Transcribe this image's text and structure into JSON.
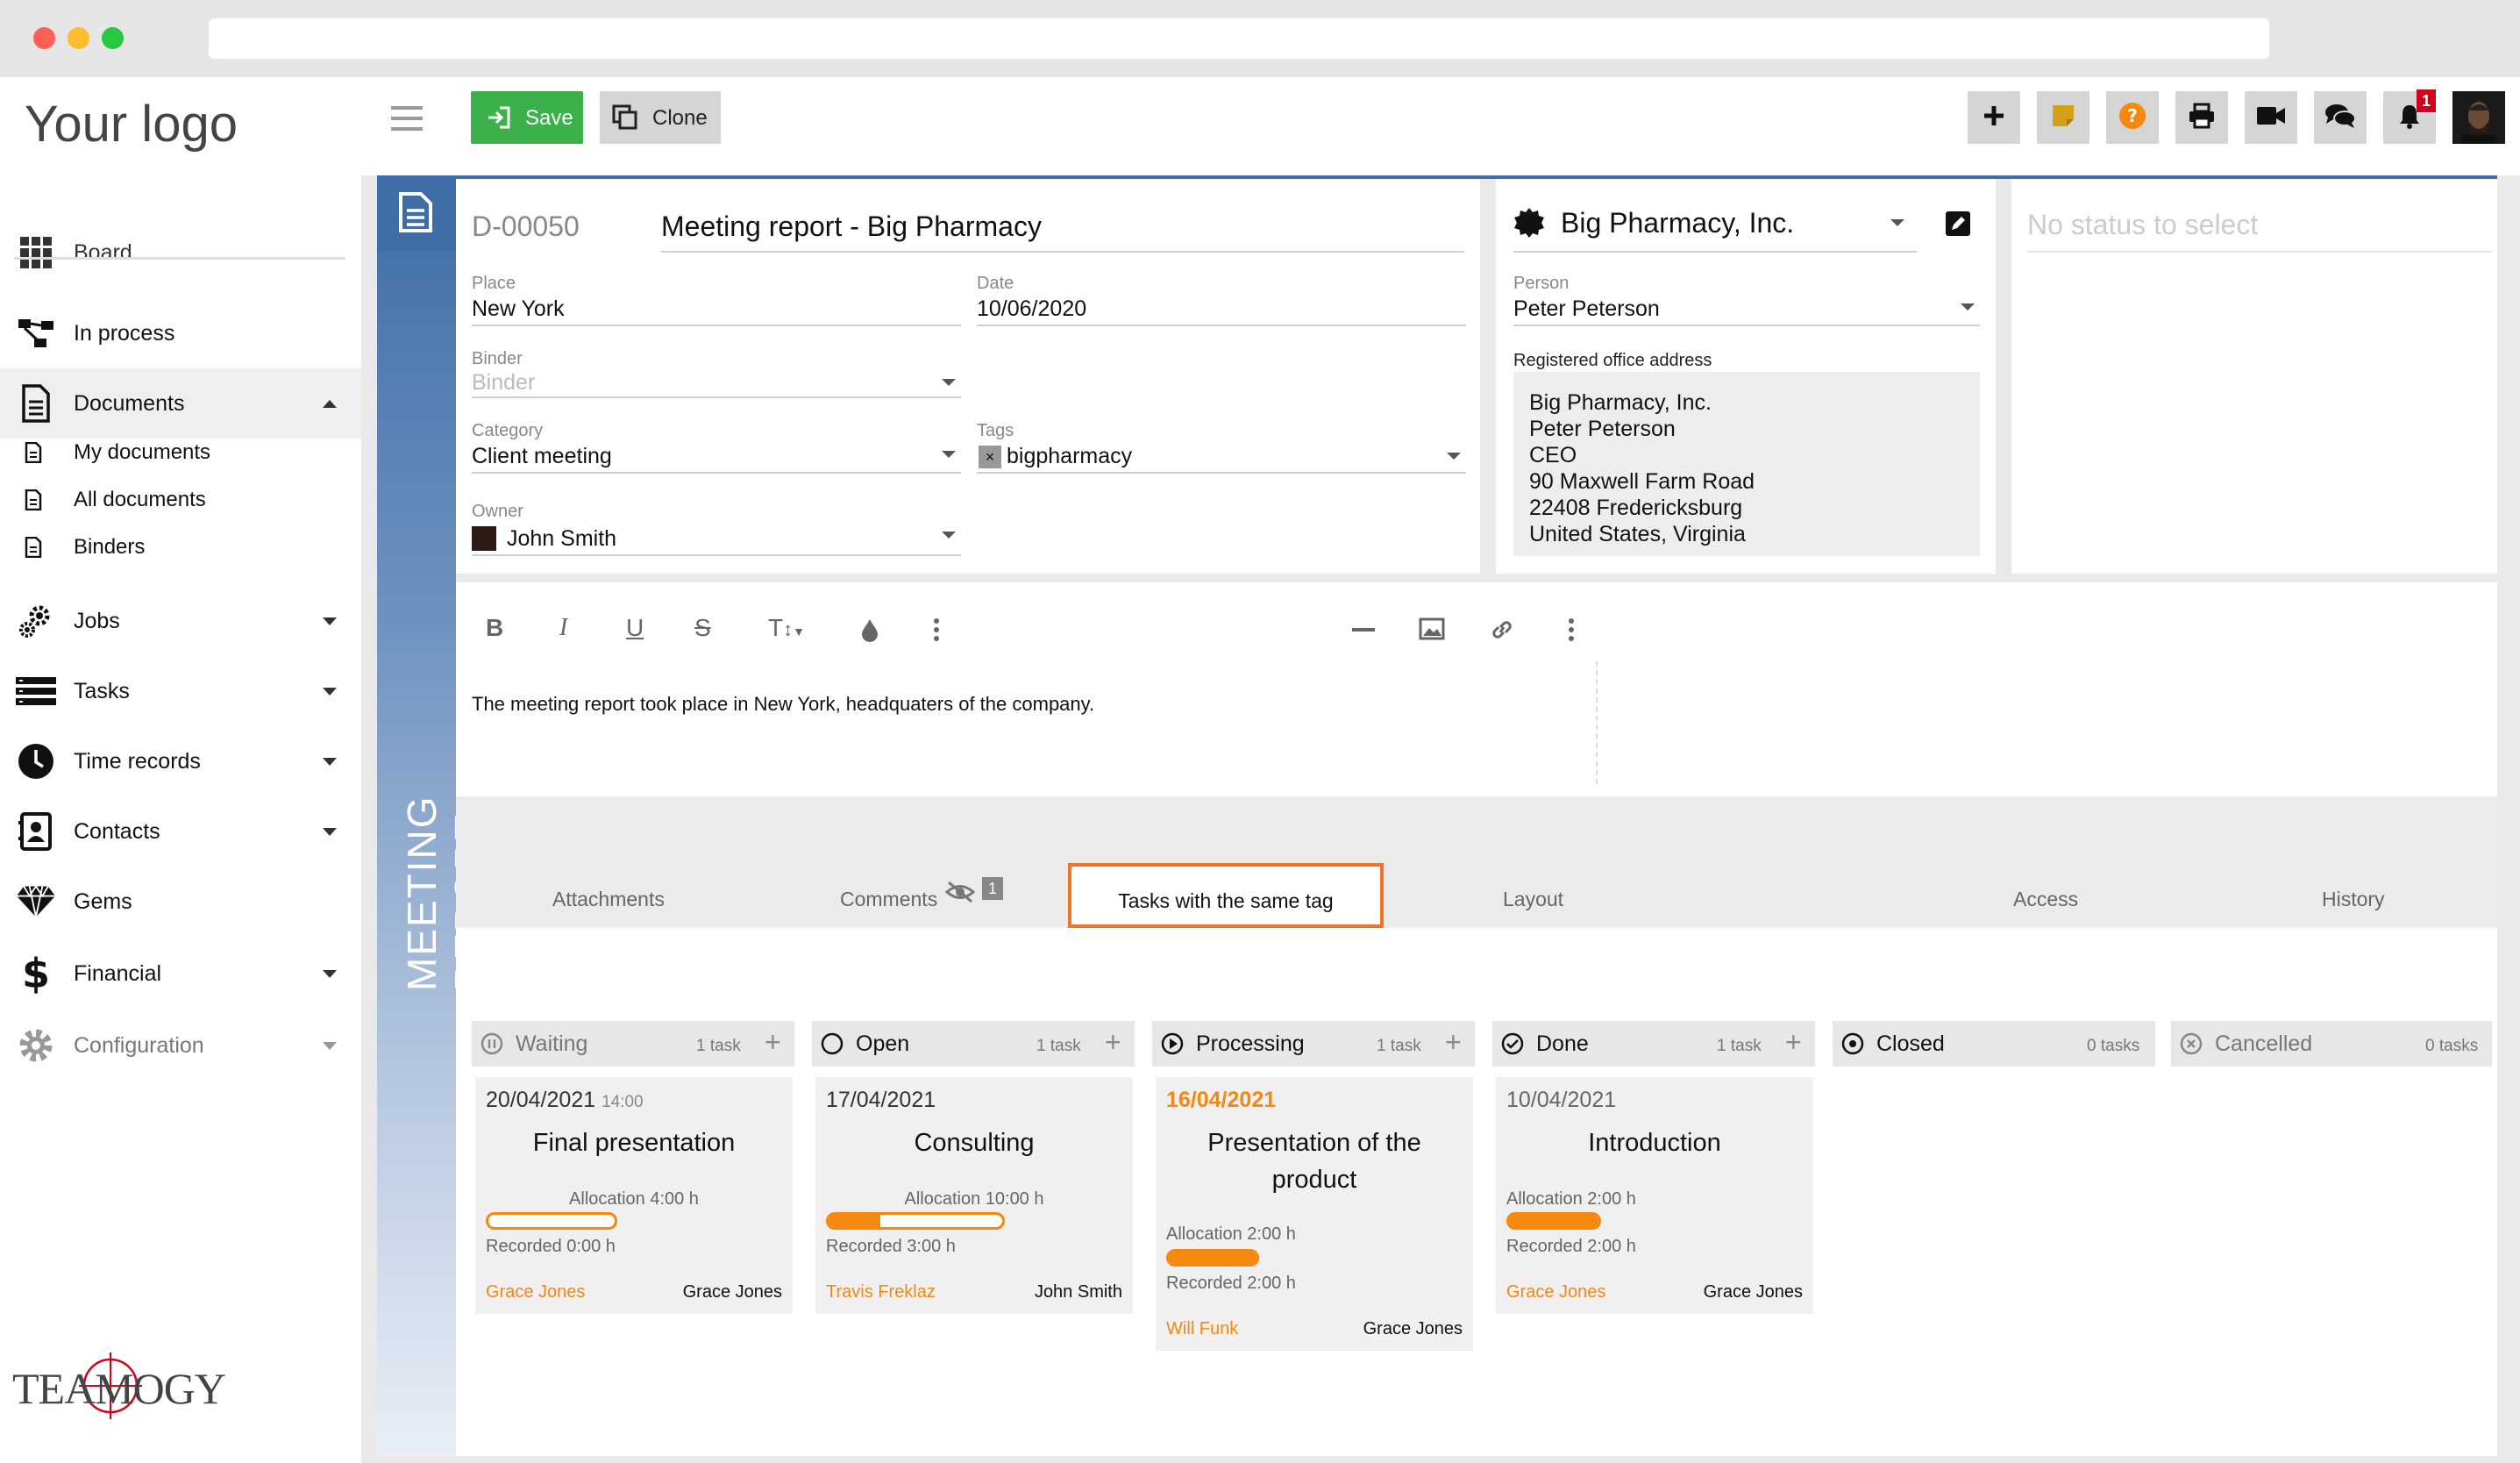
{
  "app": {
    "logo_text": "Your logo",
    "brand_text": "TEAMOGY"
  },
  "sidebar": {
    "items": [
      {
        "label": "Board",
        "icon": "grid-icon"
      },
      {
        "label": "In process",
        "icon": "flow-icon"
      },
      {
        "label": "Documents",
        "icon": "document-icon"
      },
      {
        "label": "Jobs",
        "icon": "gears-icon"
      },
      {
        "label": "Tasks",
        "icon": "tasks-icon"
      },
      {
        "label": "Time records",
        "icon": "clock-icon"
      },
      {
        "label": "Contacts",
        "icon": "contact-book-icon"
      },
      {
        "label": "Gems",
        "icon": "diamond-icon"
      },
      {
        "label": "Financial",
        "icon": "dollar-icon"
      },
      {
        "label": "Configuration",
        "icon": "gear-icon"
      }
    ],
    "documents_sub": [
      {
        "label": "My documents"
      },
      {
        "label": "All documents"
      },
      {
        "label": "Binders"
      }
    ]
  },
  "toolbar": {
    "save_label": "Save",
    "clone_label": "Clone",
    "notification_count": "1"
  },
  "document": {
    "vertical_label": "MEETING REPORT",
    "id": "D-00050",
    "title": "Meeting report - Big Pharmacy",
    "place_label": "Place",
    "place": "New York",
    "date_label": "Date",
    "date": "10/06/2020",
    "binder_label": "Binder",
    "binder_placeholder": "Binder",
    "category_label": "Category",
    "category": "Client meeting",
    "tags_label": "Tags",
    "tag": "bigpharmacy",
    "owner_label": "Owner",
    "owner": "John Smith"
  },
  "company": {
    "name": "Big Pharmacy, Inc.",
    "person_label": "Person",
    "person": "Peter Peterson",
    "address_label": "Registered office address",
    "address_lines": [
      "Big Pharmacy, Inc.",
      "Peter Peterson",
      "CEO",
      "90 Maxwell Farm Road",
      "22408 Fredericksburg",
      "United States, Virginia"
    ]
  },
  "status": {
    "placeholder": "No status to select"
  },
  "editor": {
    "content": "The meeting report took place in New York, headquaters of the company."
  },
  "tabs": [
    {
      "label": "Attachments"
    },
    {
      "label": "Comments",
      "badge": "1"
    },
    {
      "label": "Tasks with the same tag",
      "active": true
    },
    {
      "label": "Layout"
    },
    {
      "label": "Access"
    },
    {
      "label": "History"
    }
  ],
  "kanban": {
    "columns": [
      {
        "title": "Waiting",
        "count": "1 task"
      },
      {
        "title": "Open",
        "count": "1 task"
      },
      {
        "title": "Processing",
        "count": "1 task"
      },
      {
        "title": "Done",
        "count": "1 task"
      },
      {
        "title": "Closed",
        "count": "0 tasks"
      },
      {
        "title": "Cancelled",
        "count": "0 tasks"
      }
    ],
    "cards": [
      {
        "date": "20/04/2021",
        "time": "14:00",
        "title": "Final presentation",
        "allocation": "Allocation 4:00 h",
        "recorded": "Recorded 0:00 h",
        "progress": 0,
        "user_a": "Grace Jones",
        "user_b": "Grace Jones"
      },
      {
        "date": "17/04/2021",
        "time": "",
        "title": "Consulting",
        "allocation": "Allocation 10:00 h",
        "recorded": "Recorded 3:00 h",
        "progress": 0.3,
        "user_a": "Travis Freklaz",
        "user_b": "John Smith"
      },
      {
        "date": "16/04/2021",
        "time": "",
        "title": "Presentation of the product",
        "allocation": "Allocation 2:00 h",
        "recorded": "Recorded 2:00 h",
        "progress": 1.0,
        "user_a": "Will Funk",
        "user_b": "Grace Jones",
        "date_color": "#f5880f"
      },
      {
        "date": "10/04/2021",
        "time": "",
        "title": "Introduction",
        "allocation": "Allocation 2:00 h",
        "recorded": "Recorded 2:00 h",
        "progress": 1.0,
        "user_a": "Grace Jones",
        "user_b": "Grace Jones"
      }
    ]
  },
  "colors": {
    "accent_orange": "#f5880f",
    "save_green": "#3cb04a",
    "notification_red": "#d0021b",
    "header_blue": "#3f6da8"
  }
}
